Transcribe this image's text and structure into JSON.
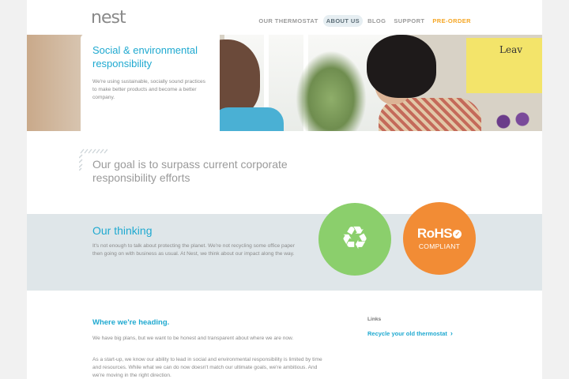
{
  "header": {
    "logo_text": "nest",
    "nav": [
      {
        "label": "OUR THERMOSTAT"
      },
      {
        "label": "ABOUT US",
        "active": true
      },
      {
        "label": "BLOG"
      },
      {
        "label": "SUPPORT"
      },
      {
        "label": "PRE-ORDER",
        "highlight_color": "#f5a623"
      }
    ]
  },
  "hero": {
    "title": "Social & environmental responsibility",
    "intro": "We're using sustainable, socially sound practices to make better products and become a better company.",
    "poster_text": "Leav"
  },
  "goal": {
    "text": "Our goal is to surpass current corporate responsibility efforts"
  },
  "thinking": {
    "title": "Our thinking",
    "body": "It's not enough to talk about protecting the planet. We're not recycling some office paper then going on with business as usual. At Nest, we think about our impact along the way.",
    "recycle_icon": "recycle-icon",
    "recycle_color": "#8bcf6c",
    "rohs_color": "#f28c35",
    "rohs_title": "RoHS",
    "rohs_subtitle": "COMPLIANT"
  },
  "heading_section": {
    "title": "Where we're heading.",
    "para1": "We have big plans, but we want to be honest and transparent about where we are now.",
    "para2": "As a start-up, we know our ability to lead in social and environmental responsibility is limited by time and resources. While what we can do now doesn't match our ultimate goals, we're ambitious. And we're moving in the right direction."
  },
  "links": {
    "title": "Links",
    "items": [
      {
        "label": "Recycle your old thermostat"
      }
    ]
  },
  "colors": {
    "accent": "#1fa9d0",
    "band_bg": "#dfe6e9"
  }
}
